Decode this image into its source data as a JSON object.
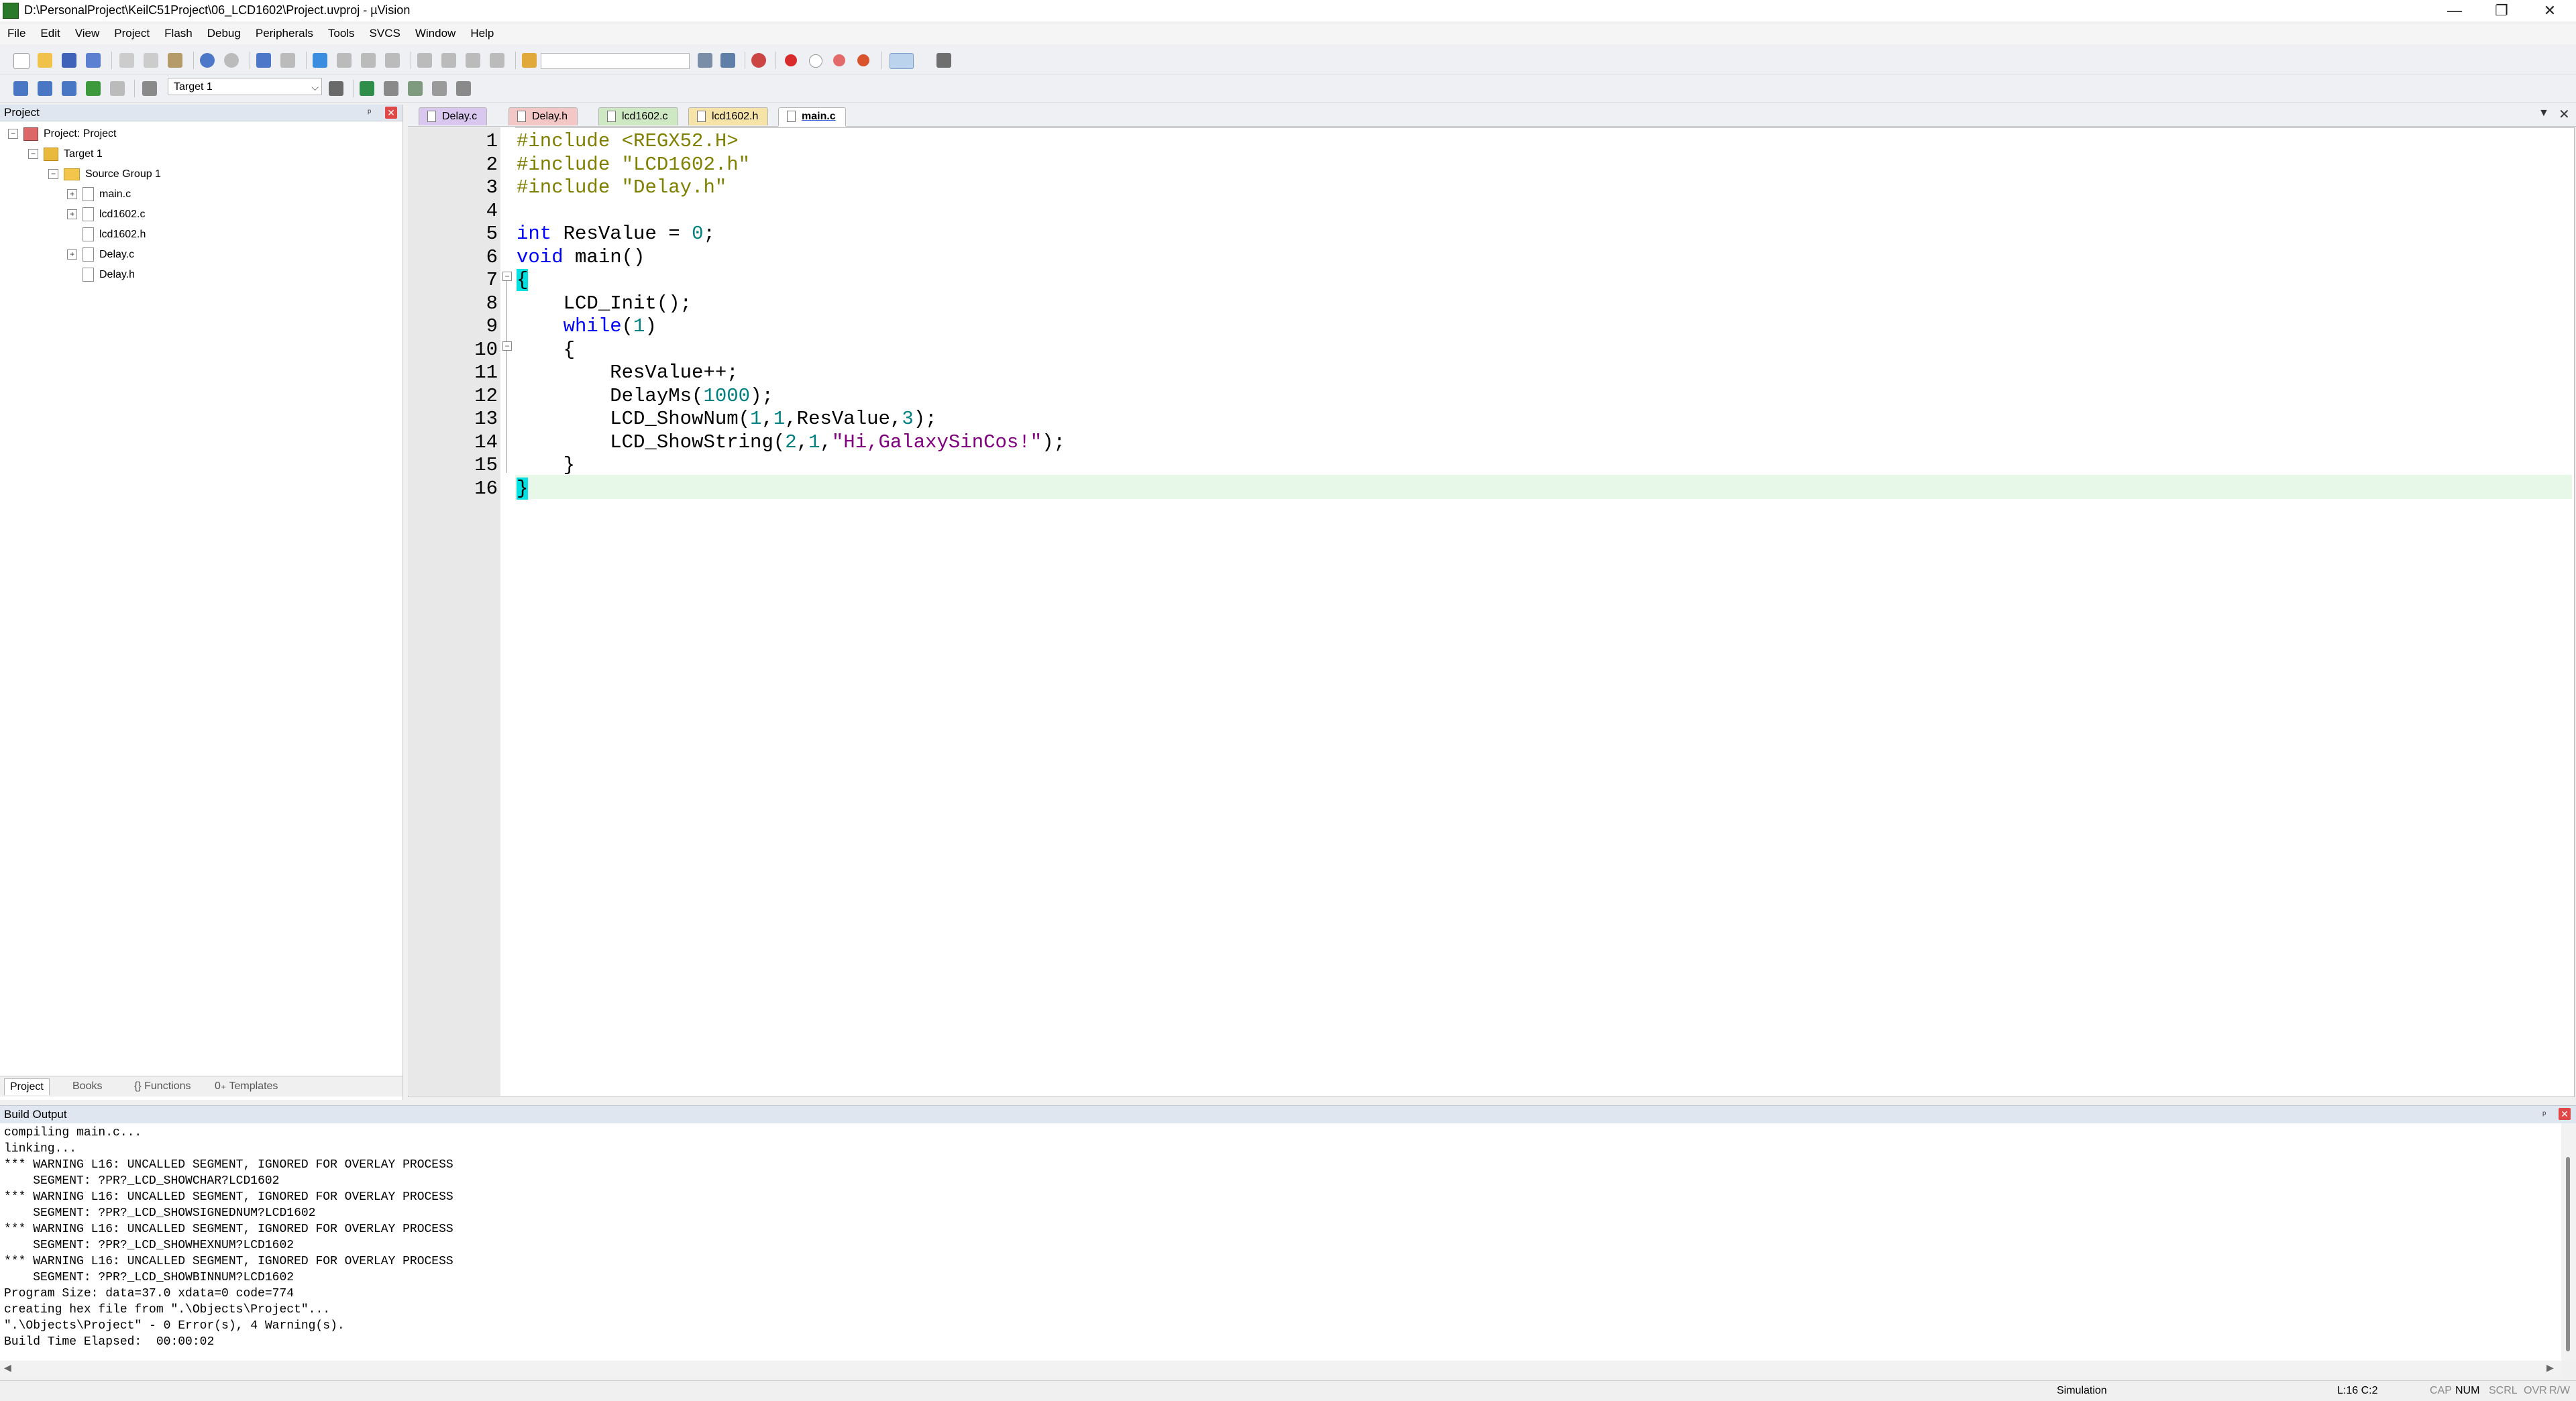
{
  "window": {
    "title": "D:\\PersonalProject\\KeilC51Project\\06_LCD1602\\Project.uvproj - µVision",
    "minimize": "—",
    "maximize": "❐",
    "close": "✕"
  },
  "menu": [
    "File",
    "Edit",
    "View",
    "Project",
    "Flash",
    "Debug",
    "Peripherals",
    "Tools",
    "SVCS",
    "Window",
    "Help"
  ],
  "toolbar": {
    "target": "Target 1"
  },
  "project_panel": {
    "title": "Project",
    "tree": {
      "project": "Project: Project",
      "target": "Target 1",
      "group": "Source Group 1",
      "files": [
        "main.c",
        "lcd1602.c",
        "lcd1602.h",
        "Delay.c",
        "Delay.h"
      ]
    },
    "tabs": [
      "Project",
      "Books",
      "{} Functions",
      "0₊ Templates"
    ]
  },
  "editor": {
    "tabs": [
      {
        "label": "Delay.c",
        "color": "#d9c7ef"
      },
      {
        "label": "Delay.h",
        "color": "#f4c7c7"
      },
      {
        "label": "lcd1602.c",
        "color": "#cfe8c4"
      },
      {
        "label": "lcd1602.h",
        "color": "#f5e3a8"
      },
      {
        "label": "main.c",
        "color": "#ffffff"
      }
    ],
    "line_numbers": [
      "1",
      "2",
      "3",
      "4",
      "5",
      "6",
      "7",
      "8",
      "9",
      "10",
      "11",
      "12",
      "13",
      "14",
      "15",
      "16"
    ],
    "code": {
      "l1_pp": "#include",
      "l1_hdr": " <REGX52.H>",
      "l2_pp": "#include",
      "l2_hdr": " \"LCD1602.h\"",
      "l3_pp": "#include",
      "l3_hdr": " \"Delay.h\"",
      "l5_kw": "int",
      "l5_rest": " ResValue = ",
      "l5_num": "0",
      "l5_end": ";",
      "l6_kw": "void",
      "l6_rest": " main()",
      "l7": "{",
      "l8": "    LCD_Init();",
      "l9_kw": "while",
      "l9_open": "(",
      "l9_num": "1",
      "l9_close": ")",
      "l10": "    {",
      "l11": "        ResValue++;",
      "l12_a": "        DelayMs(",
      "l12_num": "1000",
      "l12_b": ");",
      "l13_a": "        LCD_ShowNum(",
      "l13_n1": "1",
      "l13_c1": ",",
      "l13_n2": "1",
      "l13_b": ",ResValue,",
      "l13_n3": "3",
      "l13_c": ");",
      "l14_a": "        LCD_ShowString(",
      "l14_n1": "2",
      "l14_c1": ",",
      "l14_n2": "1",
      "l14_c2": ",",
      "l14_str": "\"Hi,GalaxySinCos!\"",
      "l14_b": ");",
      "l15": "    }",
      "l16": "}"
    }
  },
  "build_output": {
    "title": "Build Output",
    "lines": [
      "compiling main.c...",
      "linking...",
      "*** WARNING L16: UNCALLED SEGMENT, IGNORED FOR OVERLAY PROCESS",
      "    SEGMENT: ?PR?_LCD_SHOWCHAR?LCD1602",
      "*** WARNING L16: UNCALLED SEGMENT, IGNORED FOR OVERLAY PROCESS",
      "    SEGMENT: ?PR?_LCD_SHOWSIGNEDNUM?LCD1602",
      "*** WARNING L16: UNCALLED SEGMENT, IGNORED FOR OVERLAY PROCESS",
      "    SEGMENT: ?PR?_LCD_SHOWHEXNUM?LCD1602",
      "*** WARNING L16: UNCALLED SEGMENT, IGNORED FOR OVERLAY PROCESS",
      "    SEGMENT: ?PR?_LCD_SHOWBINNUM?LCD1602",
      "Program Size: data=37.0 xdata=0 code=774",
      "creating hex file from \".\\Objects\\Project\"...",
      "\".\\Objects\\Project\" - 0 Error(s), 4 Warning(s).",
      "Build Time Elapsed:  00:00:02"
    ]
  },
  "status": {
    "mode": "Simulation",
    "position": "L:16 C:2",
    "cap": "CAP",
    "num": "NUM",
    "scrl": "SCRL",
    "ovr": "OVR",
    "rw": "R/W"
  }
}
